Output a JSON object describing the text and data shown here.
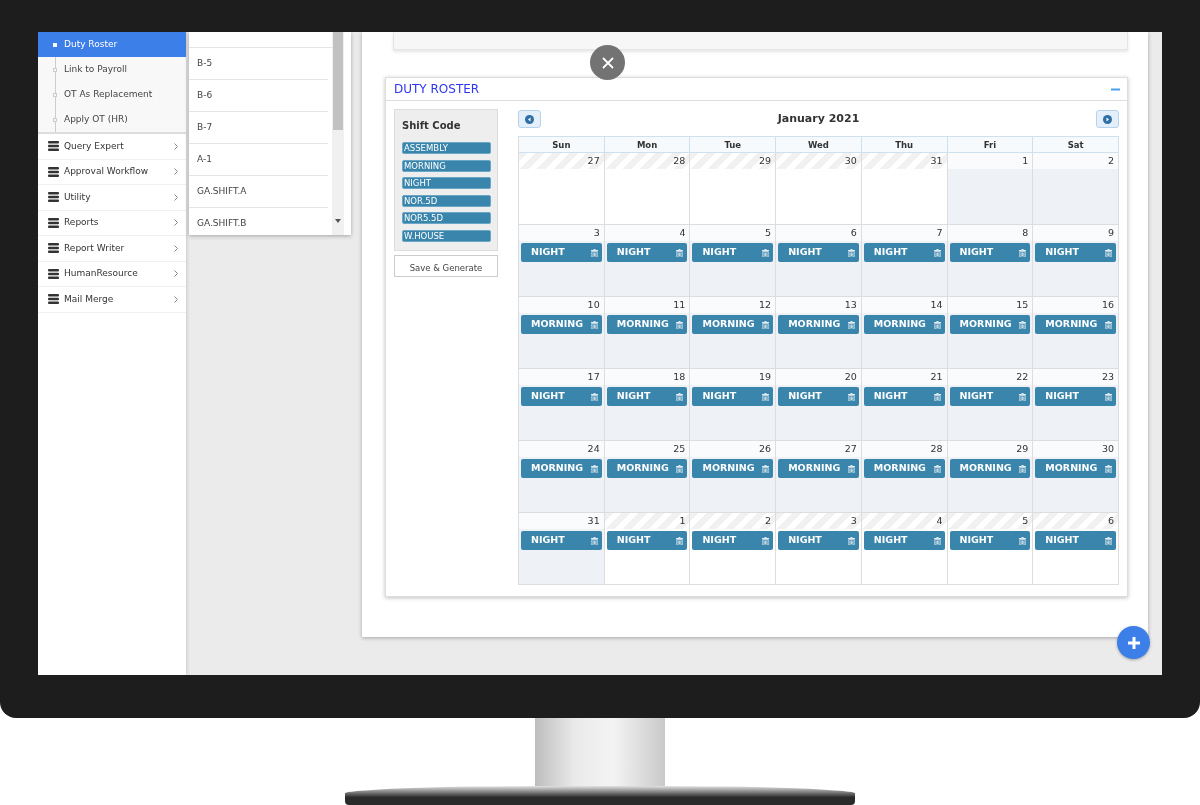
{
  "sidebar": {
    "submenu": [
      {
        "label": "Duty Roster",
        "selected": true
      },
      {
        "label": "Link to Payroll",
        "selected": false
      },
      {
        "label": "OT As Replacement",
        "selected": false
      },
      {
        "label": "Apply OT (HR)",
        "selected": false
      }
    ],
    "menu": [
      {
        "label": "Query Expert"
      },
      {
        "label": "Approval Workflow"
      },
      {
        "label": "Utility"
      },
      {
        "label": "Reports"
      },
      {
        "label": "Report Writer"
      },
      {
        "label": "HumanResource"
      },
      {
        "label": "Mail Merge"
      }
    ]
  },
  "dropdown": {
    "items": [
      "B-5",
      "B-6",
      "B-7",
      "A-1",
      "GA.SHIFT.A",
      "GA.SHIFT.B"
    ]
  },
  "roster": {
    "title": "DUTY ROSTER",
    "shift_panel": {
      "title": "Shift Code",
      "codes": [
        "ASSEMBLY",
        "MORNING",
        "NIGHT",
        "NOR.5D",
        "NOR5.5D",
        "W.HOUSE"
      ],
      "button": "Save & Generate"
    },
    "calendar": {
      "title": "January 2021",
      "weekdays": [
        "Sun",
        "Mon",
        "Tue",
        "Wed",
        "Thu",
        "Fri",
        "Sat"
      ],
      "weeks": [
        [
          {
            "day": "27",
            "other_month": true
          },
          {
            "day": "28",
            "other_month": true
          },
          {
            "day": "29",
            "other_month": true
          },
          {
            "day": "30",
            "other_month": true
          },
          {
            "day": "31",
            "other_month": true
          },
          {
            "day": "1",
            "other_month": false
          },
          {
            "day": "2",
            "other_month": false
          }
        ],
        [
          {
            "day": "3",
            "other_month": false,
            "events": [
              "NIGHT"
            ]
          },
          {
            "day": "4",
            "other_month": false,
            "events": [
              "NIGHT"
            ]
          },
          {
            "day": "5",
            "other_month": false,
            "events": [
              "NIGHT"
            ]
          },
          {
            "day": "6",
            "other_month": false,
            "events": [
              "NIGHT"
            ]
          },
          {
            "day": "7",
            "other_month": false,
            "events": [
              "NIGHT"
            ]
          },
          {
            "day": "8",
            "other_month": false,
            "events": [
              "NIGHT"
            ]
          },
          {
            "day": "9",
            "other_month": false,
            "events": [
              "NIGHT"
            ]
          }
        ],
        [
          {
            "day": "10",
            "other_month": false,
            "events": [
              "MORNING"
            ]
          },
          {
            "day": "11",
            "other_month": false,
            "events": [
              "MORNING"
            ]
          },
          {
            "day": "12",
            "other_month": false,
            "events": [
              "MORNING"
            ]
          },
          {
            "day": "13",
            "other_month": false,
            "events": [
              "MORNING"
            ]
          },
          {
            "day": "14",
            "other_month": false,
            "events": [
              "MORNING"
            ]
          },
          {
            "day": "15",
            "other_month": false,
            "events": [
              "MORNING"
            ]
          },
          {
            "day": "16",
            "other_month": false,
            "events": [
              "MORNING"
            ]
          }
        ],
        [
          {
            "day": "17",
            "other_month": false,
            "events": [
              "NIGHT"
            ]
          },
          {
            "day": "18",
            "other_month": false,
            "events": [
              "NIGHT"
            ]
          },
          {
            "day": "19",
            "other_month": false,
            "events": [
              "NIGHT"
            ]
          },
          {
            "day": "20",
            "other_month": false,
            "events": [
              "NIGHT"
            ]
          },
          {
            "day": "21",
            "other_month": false,
            "events": [
              "NIGHT"
            ]
          },
          {
            "day": "22",
            "other_month": false,
            "events": [
              "NIGHT"
            ]
          },
          {
            "day": "23",
            "other_month": false,
            "events": [
              "NIGHT"
            ]
          }
        ],
        [
          {
            "day": "24",
            "other_month": false,
            "events": [
              "MORNING"
            ]
          },
          {
            "day": "25",
            "other_month": false,
            "events": [
              "MORNING"
            ]
          },
          {
            "day": "26",
            "other_month": false,
            "events": [
              "MORNING"
            ]
          },
          {
            "day": "27",
            "other_month": false,
            "events": [
              "MORNING"
            ]
          },
          {
            "day": "28",
            "other_month": false,
            "events": [
              "MORNING"
            ]
          },
          {
            "day": "29",
            "other_month": false,
            "events": [
              "MORNING"
            ]
          },
          {
            "day": "30",
            "other_month": false,
            "events": [
              "MORNING"
            ]
          }
        ],
        [
          {
            "day": "31",
            "other_month": false,
            "events": [
              "NIGHT"
            ]
          },
          {
            "day": "1",
            "other_month": true,
            "events": [
              "NIGHT"
            ]
          },
          {
            "day": "2",
            "other_month": true,
            "events": [
              "NIGHT"
            ]
          },
          {
            "day": "3",
            "other_month": true,
            "events": [
              "NIGHT"
            ]
          },
          {
            "day": "4",
            "other_month": true,
            "events": [
              "NIGHT"
            ]
          },
          {
            "day": "5",
            "other_month": true,
            "events": [
              "NIGHT"
            ]
          },
          {
            "day": "6",
            "other_month": true,
            "events": [
              "NIGHT"
            ]
          }
        ]
      ]
    }
  }
}
